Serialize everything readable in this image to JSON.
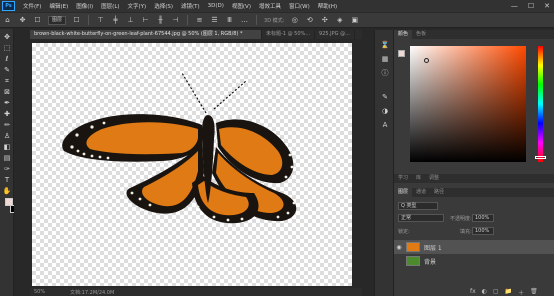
{
  "menubar": {
    "logo": "Ps",
    "items": [
      "文件(F)",
      "编辑(E)",
      "图像(I)",
      "图层(L)",
      "文字(Y)",
      "选择(S)",
      "滤镜(T)",
      "3D(D)",
      "视图(V)",
      "增效工具",
      "窗口(W)",
      "帮助(H)"
    ],
    "window_controls": [
      "—",
      "☐",
      "✕"
    ]
  },
  "optionsbar": {
    "auto_select_value": "图层",
    "mode_3d_label": "3D 模式:"
  },
  "tabs": [
    {
      "label": "brown-black-white-butterfly-on-green-leaf-plant-67544.jpg @ 50% (图层 1, RGB/8) *",
      "active": true
    },
    {
      "label": "未标题-1 @ 50%...",
      "active": false
    },
    {
      "label": "925.JPG @...",
      "active": false
    }
  ],
  "statusbar": {
    "zoom": "50%",
    "doc_info": "文档:17.2M/24.0M"
  },
  "color_panel": {
    "tabs": [
      "颜色",
      "色板"
    ],
    "foreground": "#f0d9d4",
    "hue_color": "#ff4a00"
  },
  "learn_panel": {
    "tabs": [
      "学习",
      "库",
      "调整"
    ]
  },
  "layers_panel": {
    "tabs": [
      "图层",
      "通道",
      "路径"
    ],
    "filter_kind": "Q 类型",
    "blend_mode": "正常",
    "opacity_label": "不透明度:",
    "opacity_value": "100%",
    "lock_label": "锁定:",
    "fill_label": "填充:",
    "fill_value": "100%",
    "layers": [
      {
        "name": "图层 1",
        "selected": true
      },
      {
        "name": "背景",
        "selected": false
      }
    ],
    "footer_icons": [
      "fx",
      "◐",
      "▢",
      "📁",
      "＋",
      "🗑"
    ]
  },
  "colors": {
    "wing_orange": "#e07a14",
    "wing_black": "#1a1410"
  }
}
